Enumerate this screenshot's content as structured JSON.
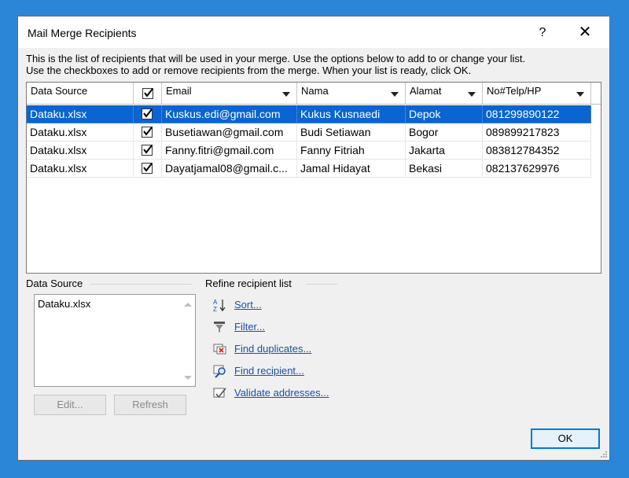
{
  "dialog": {
    "title": "Mail Merge Recipients",
    "help": "?",
    "close": "✕",
    "instructions": [
      "This is the list of recipients that will be used in your merge.  Use the options below to add to or change your list.",
      "Use the checkboxes to add or remove recipients from the merge.  When your list is ready, click OK."
    ]
  },
  "grid": {
    "columns": [
      "Data Source",
      "",
      "Email",
      "Nama",
      "Alamat",
      "No#Telp/HP"
    ],
    "rows": [
      {
        "source": "Dataku.xlsx",
        "checked": true,
        "email": "Kuskus.edi@gmail.com",
        "nama": "Kukus Kusnaedi",
        "alamat": "Depok",
        "telp": "081299890122"
      },
      {
        "source": "Dataku.xlsx",
        "checked": true,
        "email": "Busetiawan@gmail.com",
        "nama": "Budi Setiawan",
        "alamat": "Bogor",
        "telp": "089899217823"
      },
      {
        "source": "Dataku.xlsx",
        "checked": true,
        "email": "Fanny.fitri@gmail.com",
        "nama": "Fanny Fitriah",
        "alamat": "Jakarta",
        "telp": "083812784352"
      },
      {
        "source": "Dataku.xlsx",
        "checked": true,
        "email": "Dayatjamal08@gmail.c...",
        "nama": "Jamal Hidayat",
        "alamat": "Bekasi",
        "telp": "082137629976"
      }
    ]
  },
  "data_source": {
    "label": "Data Source",
    "items": [
      "Dataku.xlsx"
    ],
    "edit": "Edit...",
    "refresh": "Refresh"
  },
  "refine": {
    "label": "Refine recipient list",
    "links": [
      "Sort...",
      "Filter...",
      "Find duplicates...",
      "Find recipient...",
      "Validate addresses..."
    ]
  },
  "ok": "OK",
  "colors": {
    "accent": "#0a64d2",
    "link": "#1a4fa8",
    "background": "#2b86d8"
  }
}
